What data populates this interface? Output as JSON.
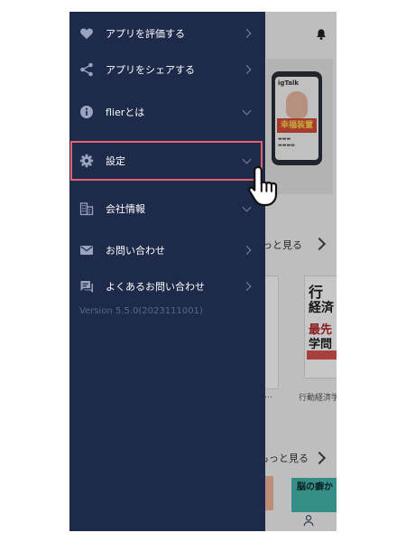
{
  "drawer": {
    "items": [
      {
        "label": "アプリを評価する",
        "icon": "heart-icon",
        "chevron": "right"
      },
      {
        "label": "アプリをシェアする",
        "icon": "share-icon",
        "chevron": "right"
      },
      {
        "label": "flierとは",
        "icon": "info-icon",
        "chevron": "down"
      },
      {
        "label": "設定",
        "icon": "gear-icon",
        "chevron": "down",
        "highlighted": true
      },
      {
        "label": "会社情報",
        "icon": "building-icon",
        "chevron": "down"
      },
      {
        "label": "お問い合わせ",
        "icon": "mail-icon",
        "chevron": "right"
      },
      {
        "label": "よくあるお問い合わせ",
        "icon": "chat-icon",
        "chevron": "right"
      }
    ],
    "version": "Version 5.5.0(2023111001)"
  },
  "background": {
    "banner": {
      "brand": "igTalk",
      "title": "幸福装置"
    },
    "more_link_1": "っと見る",
    "more_link_2": "もっと見る",
    "book": {
      "line1": "行",
      "line2": "経済",
      "line3": "最先",
      "line4": "学問"
    },
    "book_caption": "行動経済学",
    "card_left_caption": "…",
    "tile_text": "脳の癖か"
  },
  "colors": {
    "drawer_bg": "#1e2a4a",
    "highlight_border": "#e5626b",
    "label_text": "#ffffff",
    "version_text": "#5b6787",
    "chevron": "#7c879f"
  }
}
